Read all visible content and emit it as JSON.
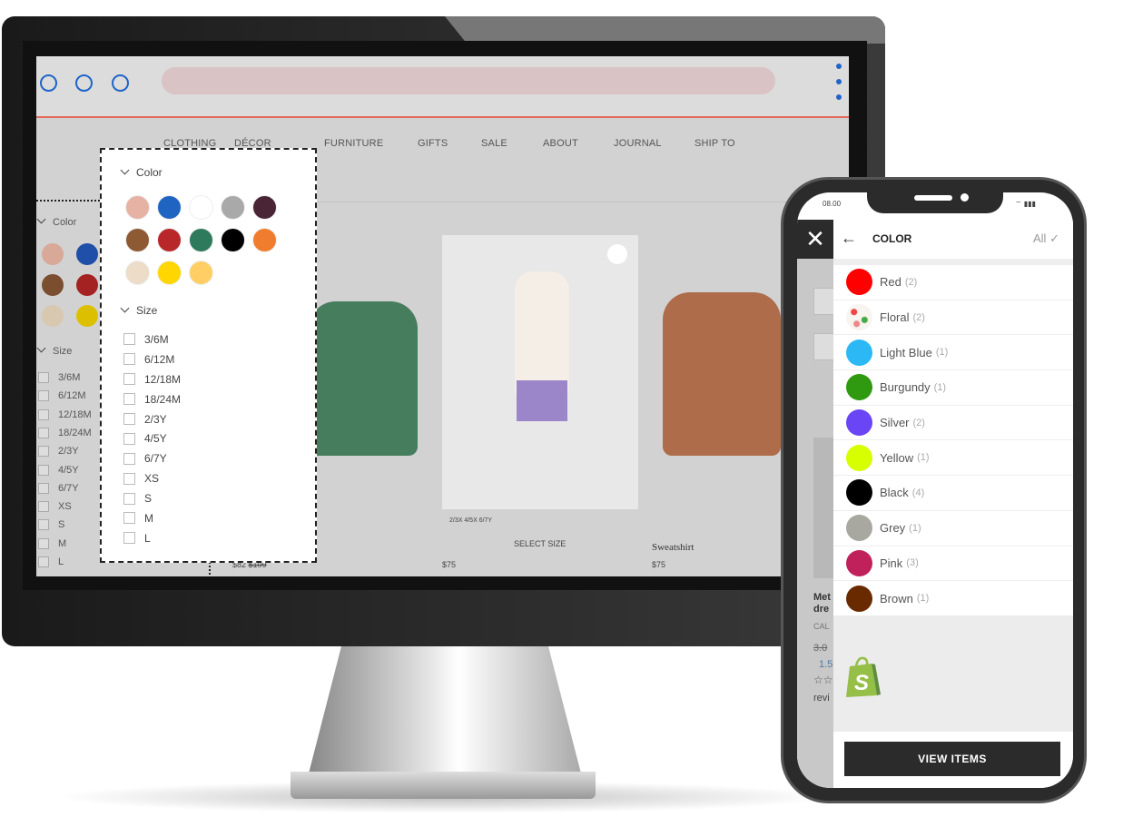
{
  "browser": {
    "nav": [
      "CLOTHING",
      "DÉCOR",
      "FURNITURE",
      "GIFTS",
      "SALE",
      "ABOUT",
      "JOURNAL",
      "SHIP TO"
    ],
    "sidebar": {
      "color_label": "Color",
      "size_label": "Size",
      "swatches": [
        "#d8a898",
        "#1f4fa8",
        "#7a4e2e",
        "#a52222",
        "#d9c8b0",
        "#dcc000"
      ],
      "sizes": [
        "3/6M",
        "6/12M",
        "12/18M",
        "18/24M",
        "2/3Y",
        "4/5Y",
        "6/7Y",
        "XS",
        "S",
        "M",
        "L"
      ]
    },
    "panel": {
      "color_label": "Color",
      "size_label": "Size",
      "swatches": [
        "#e6b2a4",
        "#1f64c0",
        "#ffffff",
        "#a9a9a9",
        "#4a2536",
        "#8e5a34",
        "#b8282a",
        "#2e7a5c",
        "#000000",
        "#f07d2e",
        "#ecdcc8",
        "#ffd600",
        "#ffcf66"
      ],
      "sizes": [
        "3/6M",
        "6/12M",
        "12/18M",
        "18/24M",
        "2/3Y",
        "4/5Y",
        "6/7Y",
        "XS",
        "S",
        "M",
        "L"
      ]
    },
    "products": [
      {
        "price": "$82",
        "old_price": "$109"
      },
      {
        "sizes": "2/3X  4/5X  6/7Y",
        "action": "SELECT SIZE",
        "price": "$75"
      },
      {
        "name": "Sweatshirt",
        "price": "$75"
      }
    ]
  },
  "phone": {
    "time": "08.00",
    "title": "COLOR",
    "all_label": "All",
    "colors": [
      {
        "name": "Red",
        "count": "(2)",
        "color": "#ff0000"
      },
      {
        "name": "Floral",
        "count": "(2)",
        "color": "floral"
      },
      {
        "name": "Light Blue",
        "count": "(1)",
        "color": "#2bb8f5"
      },
      {
        "name": "Burgundy",
        "count": "(1)",
        "color": "#2f9a10"
      },
      {
        "name": "Silver",
        "count": "(2)",
        "color": "#6a45f5"
      },
      {
        "name": "Yellow",
        "count": "(1)",
        "color": "#d8ff00"
      },
      {
        "name": "Black",
        "count": "(4)",
        "color": "#000000"
      },
      {
        "name": "Grey",
        "count": "(1)",
        "color": "#a8a8a0"
      },
      {
        "name": "Pink",
        "count": "(3)",
        "color": "#c0215a"
      },
      {
        "name": "Brown",
        "count": "(1)",
        "color": "#6a2a00"
      }
    ],
    "background_page": {
      "title_line1": "Met",
      "title_line2": "dre",
      "brand": "CAL",
      "old_price": "3.0",
      "price": "1.5",
      "reviews": "revi"
    },
    "view_items_label": "VIEW ITEMS"
  }
}
